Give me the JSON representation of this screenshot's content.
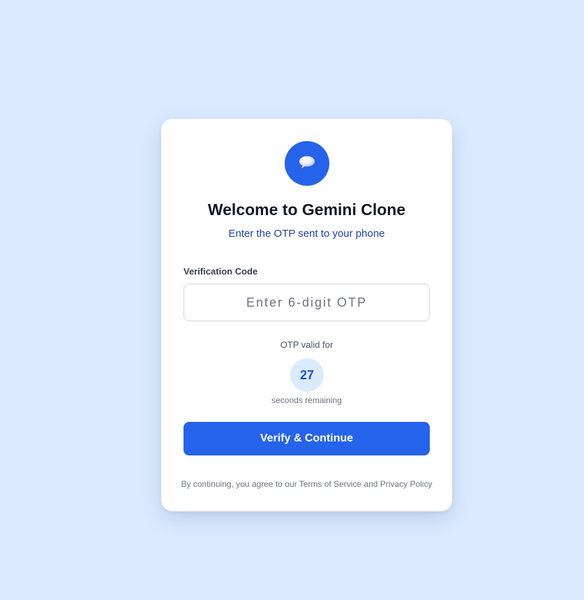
{
  "app": {
    "title": "Welcome to Gemini Clone",
    "subtitle": "Enter the OTP sent to your phone",
    "logo_icon": "chat-bubble-icon",
    "accent_color": "#2563eb",
    "background_color": "#dbeafe"
  },
  "form": {
    "otp_label": "Verification Code",
    "otp_value": "",
    "otp_placeholder": "Enter 6-digit OTP"
  },
  "timer": {
    "label": "OTP valid for",
    "seconds": "27",
    "unit_text": "seconds remaining"
  },
  "actions": {
    "verify_label": "Verify & Continue"
  },
  "footer": {
    "text": "By continuing, you agree to our Terms of Service and Privacy Policy"
  }
}
